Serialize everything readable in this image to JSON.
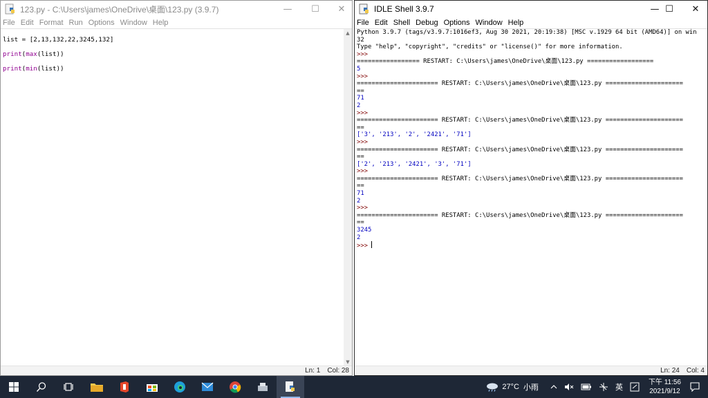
{
  "editor": {
    "title": "123.py - C:\\Users\\james\\OneDrive\\桌面\\123.py (3.9.7)",
    "menu": [
      "File",
      "Edit",
      "Format",
      "Run",
      "Options",
      "Window",
      "Help"
    ],
    "code": [
      {
        "a": "list = [2,13,132,22,3245,132]",
        "b": "",
        "c": ""
      },
      {
        "a": "print",
        "b": "(",
        "c": "max",
        "d": "(list))"
      },
      {
        "a": "print",
        "b": "(",
        "c": "min",
        "d": "(list))"
      }
    ],
    "status": {
      "line": "Ln: 1",
      "col": "Col: 28"
    }
  },
  "shell": {
    "title": "IDLE Shell 3.9.7",
    "menu": [
      "File",
      "Edit",
      "Shell",
      "Debug",
      "Options",
      "Window",
      "Help"
    ],
    "lines": [
      {
        "t": "Python 3.9.7 (tags/v3.9.7:1016ef3, Aug 30 2021, 20:19:38) [MSC v.1929 64 bit (AMD64)] on win",
        "k": "plain"
      },
      {
        "t": "32",
        "k": "plain"
      },
      {
        "t": "Type \"help\", \"copyright\", \"credits\" or \"license()\" for more information.",
        "k": "plain"
      },
      {
        "t": ">>> ",
        "k": "prompt"
      },
      {
        "t": "================= RESTART: C:\\Users\\james\\OneDrive\\桌面\\123.py ==================",
        "k": "plain"
      },
      {
        "t": "5",
        "k": "out"
      },
      {
        "t": ">>> ",
        "k": "prompt"
      },
      {
        "t": "====================== RESTART: C:\\Users\\james\\OneDrive\\桌面\\123.py =====================",
        "k": "plain"
      },
      {
        "t": "==",
        "k": "plain"
      },
      {
        "t": "71",
        "k": "out"
      },
      {
        "t": "2",
        "k": "out"
      },
      {
        "t": ">>> ",
        "k": "prompt"
      },
      {
        "t": "====================== RESTART: C:\\Users\\james\\OneDrive\\桌面\\123.py =====================",
        "k": "plain"
      },
      {
        "t": "==",
        "k": "plain"
      },
      {
        "t": "['3', '213', '2', '2421', '71']",
        "k": "out"
      },
      {
        "t": ">>> ",
        "k": "prompt"
      },
      {
        "t": "====================== RESTART: C:\\Users\\james\\OneDrive\\桌面\\123.py =====================",
        "k": "plain"
      },
      {
        "t": "==",
        "k": "plain"
      },
      {
        "t": "['2', '213', '2421', '3', '71']",
        "k": "out"
      },
      {
        "t": ">>> ",
        "k": "prompt"
      },
      {
        "t": "====================== RESTART: C:\\Users\\james\\OneDrive\\桌面\\123.py =====================",
        "k": "plain"
      },
      {
        "t": "==",
        "k": "plain"
      },
      {
        "t": "71",
        "k": "out"
      },
      {
        "t": "2",
        "k": "out"
      },
      {
        "t": ">>> ",
        "k": "prompt"
      },
      {
        "t": "====================== RESTART: C:\\Users\\james\\OneDrive\\桌面\\123.py =====================",
        "k": "plain"
      },
      {
        "t": "==",
        "k": "plain"
      },
      {
        "t": "3245",
        "k": "out"
      },
      {
        "t": "2",
        "k": "out"
      },
      {
        "t": ">>> ",
        "k": "prompt",
        "cursor": true
      }
    ],
    "status": {
      "line": "Ln: 24",
      "col": "Col: 4"
    }
  },
  "window_controls": {
    "minimize": "—",
    "maximize": "☐",
    "close": "✕"
  },
  "taskbar": {
    "weather_temp": "27°C",
    "weather_desc": "小雨",
    "ime": "英",
    "time": "下午 11:56",
    "date": "2021/9/12"
  },
  "colors": {
    "builtin": "#900090",
    "output": "#0000c0",
    "prompt": "#800000",
    "taskbar": "#1e2736"
  }
}
